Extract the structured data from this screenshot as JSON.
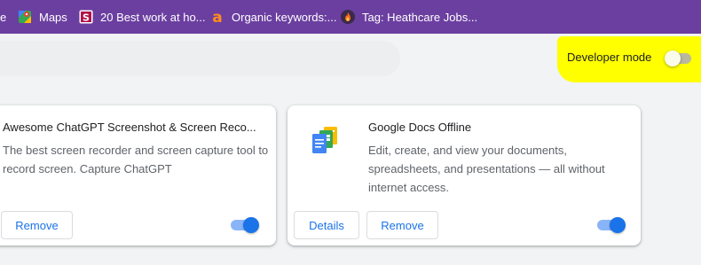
{
  "bookmarks": {
    "partial": "e",
    "items": [
      {
        "label": "Maps",
        "icon": "google-maps-icon"
      },
      {
        "label": "20 Best work at ho...",
        "icon": "s-logo-icon"
      },
      {
        "label": "Organic keywords:...",
        "icon": "a-logo-icon"
      },
      {
        "label": "Tag: Heathcare Jobs...",
        "icon": "flame-logo-icon"
      }
    ]
  },
  "developer_mode": {
    "label": "Developer mode",
    "enabled": false,
    "highlight_color": "#ffff00"
  },
  "extensions": [
    {
      "name": "Awesome ChatGPT Screenshot & Screen Reco...",
      "description": "The best screen recorder and screen capture tool to record screen. Capture ChatGPT",
      "remove_label": "Remove",
      "enabled": true
    },
    {
      "name": "Google Docs Offline",
      "description": "Edit, create, and view your documents, spreadsheets, and presentations — all without internet access.",
      "details_label": "Details",
      "remove_label": "Remove",
      "enabled": true,
      "icon": "google-docs-icon"
    }
  ],
  "colors": {
    "bookmark_bar": "#6b3fa0",
    "accent": "#1a73e8",
    "background": "#f1f3f4"
  }
}
